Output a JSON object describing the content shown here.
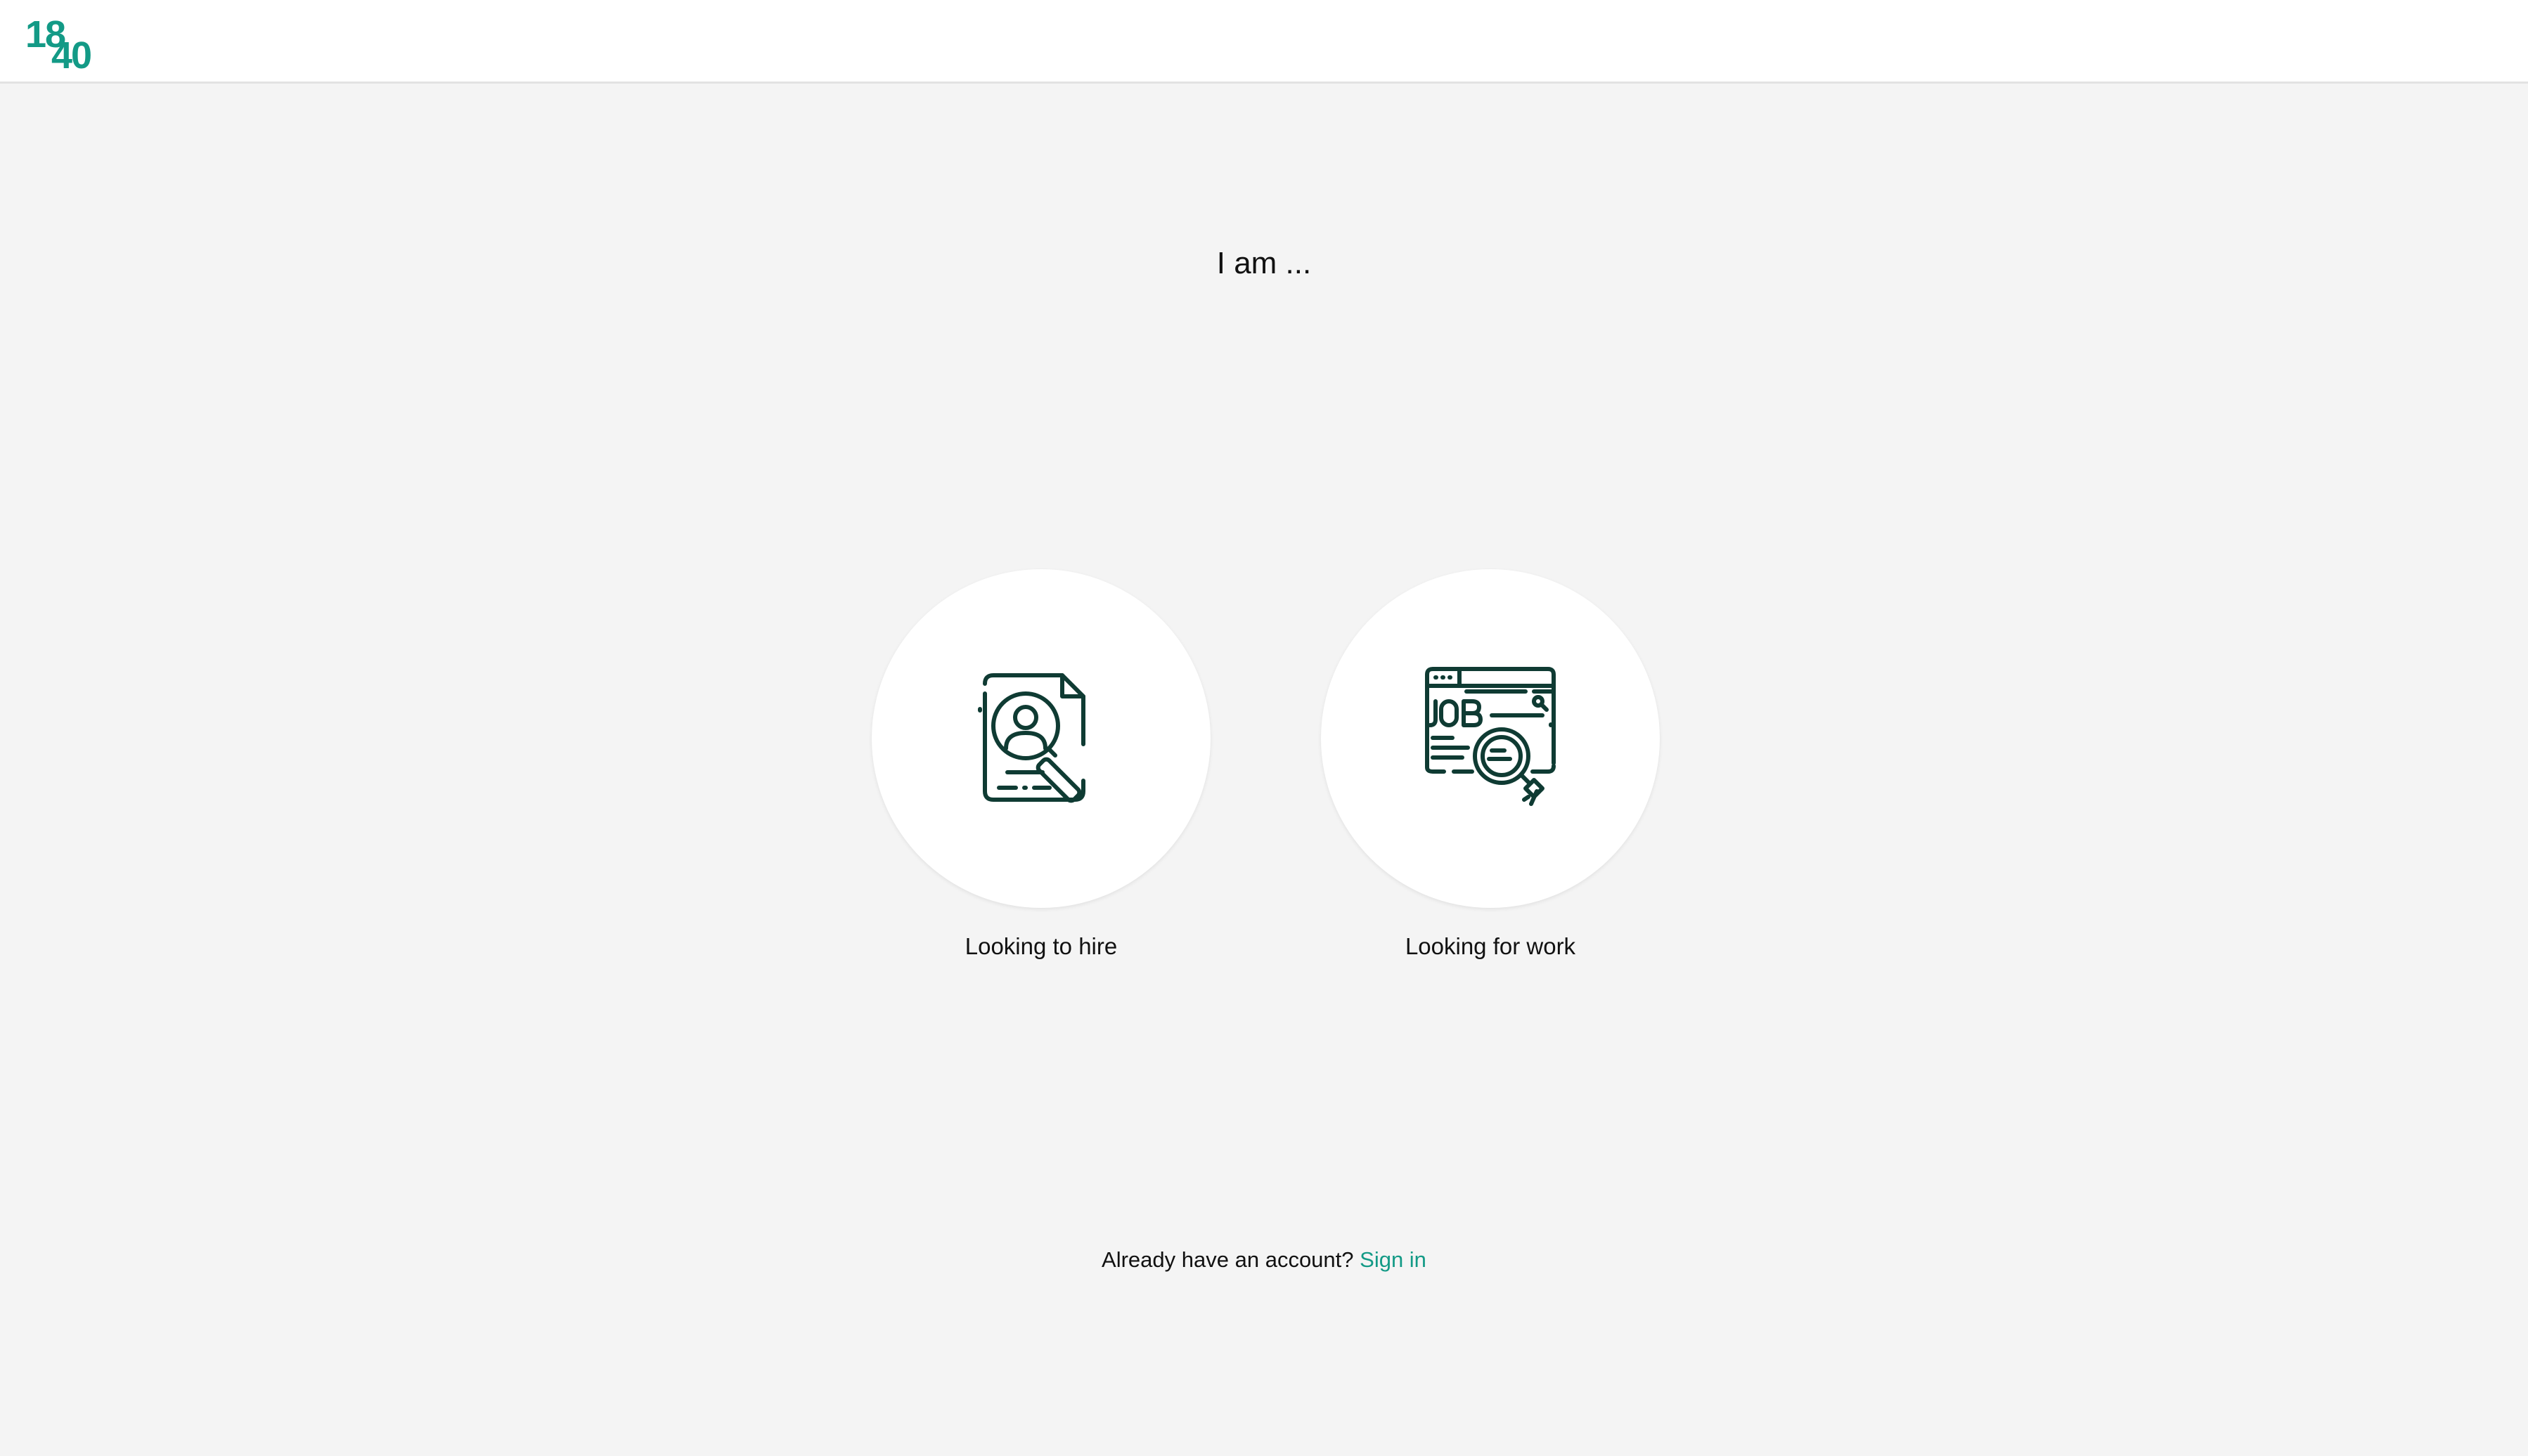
{
  "brand": {
    "logo_top": "18",
    "logo_bottom": "40",
    "logo_color": "#139a86"
  },
  "page": {
    "title": "I am ..."
  },
  "options": [
    {
      "label": "Looking to hire",
      "icon": "candidate-search-icon"
    },
    {
      "label": "Looking for work",
      "icon": "job-search-icon"
    }
  ],
  "footer": {
    "prompt": "Already have an account?",
    "signin_label": "Sign in"
  },
  "colors": {
    "accent": "#139a86",
    "icon_stroke": "#0f3b33",
    "background": "#f4f4f4"
  }
}
